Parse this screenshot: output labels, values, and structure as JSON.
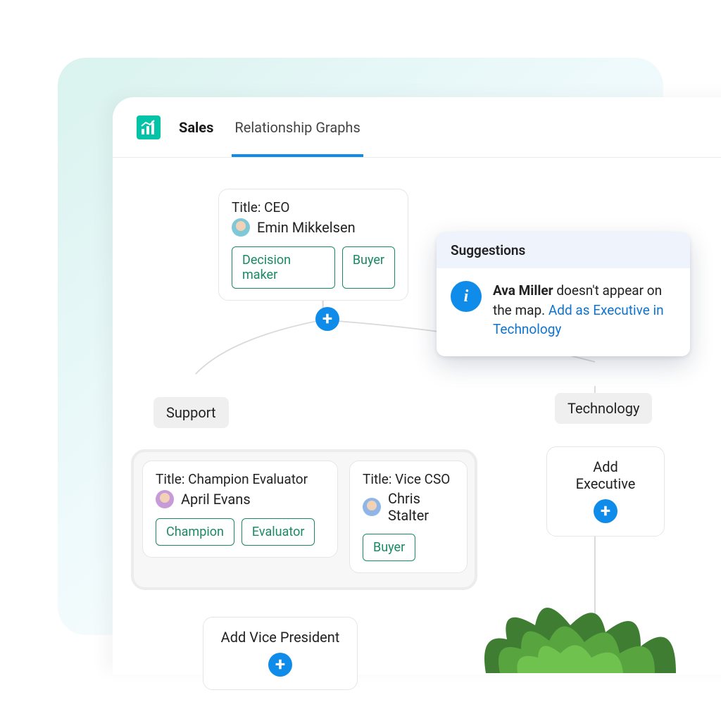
{
  "tabs": {
    "sales": "Sales",
    "relationship_graphs": "Relationship Graphs"
  },
  "nodes": {
    "ceo": {
      "title": "Title: CEO",
      "name": "Emin Mikkelsen",
      "tags": [
        "Decision maker",
        "Buyer"
      ]
    },
    "support_dept": "Support",
    "technology_dept": "Technology",
    "april": {
      "title": "Title: Champion Evaluator",
      "name": "April Evans",
      "tags": [
        "Champion",
        "Evaluator"
      ]
    },
    "chris": {
      "title": "Title: Vice CSO",
      "name": "Chris Stalter",
      "tags": [
        "Buyer"
      ]
    },
    "add_executive": "Add Executive",
    "add_vp": "Add Vice President"
  },
  "suggestions": {
    "heading": "Suggestions",
    "person": "Ava Miller",
    "text_after_name": " doesn't appear on the map. ",
    "link": "Add as Executive in Technology"
  }
}
